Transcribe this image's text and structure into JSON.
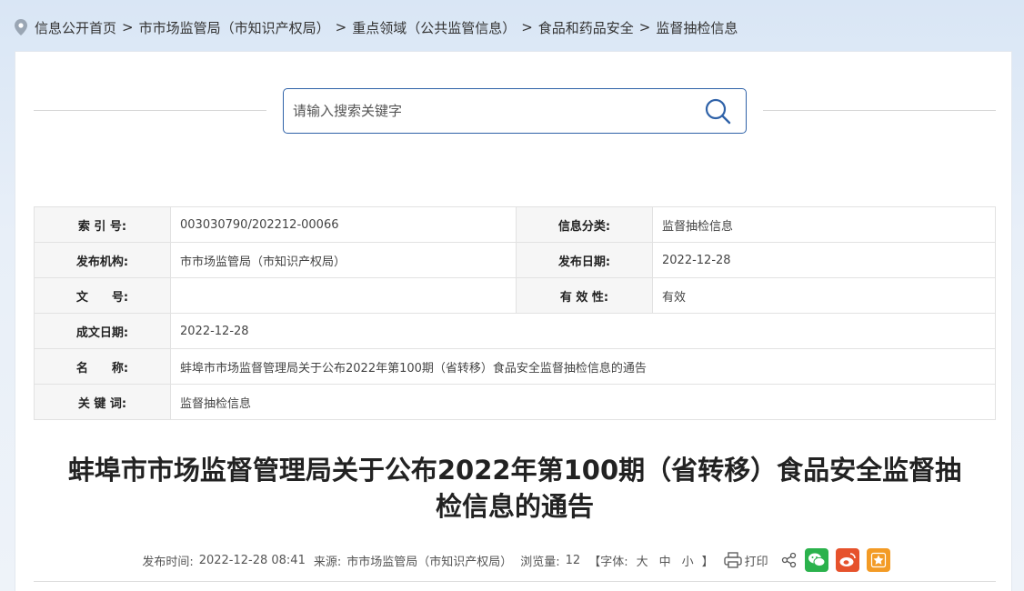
{
  "breadcrumb": {
    "items": [
      "信息公开首页",
      "市市场监管局（市知识产权局）",
      "重点领域（公共监管信息）",
      "食品和药品安全",
      "监督抽检信息"
    ],
    "separator": ">"
  },
  "search": {
    "placeholder": "请输入搜索关键字"
  },
  "meta": {
    "index_label": "索 引 号:",
    "index_value": "003030790/202212-00066",
    "category_label": "信息分类:",
    "category_value": "监督抽检信息",
    "publisher_label": "发布机构:",
    "publisher_value": "市市场监管局（市知识产权局）",
    "pubdate_label": "发布日期:",
    "pubdate_value": "2022-12-28",
    "docno_label": "文　　号:",
    "docno_value": "",
    "validity_label": "有 效 性:",
    "validity_value": "有效",
    "created_label": "成文日期:",
    "created_value": "2022-12-28",
    "name_label": "名　　称:",
    "name_value": "蚌埠市市场监督管理局关于公布2022年第100期（省转移）食品安全监督抽检信息的通告",
    "keywords_label": "关 键 词:",
    "keywords_value": "监督抽检信息"
  },
  "article": {
    "title_line1": "蚌埠市市场监督管理局关于公布2022年第100期（省转移）食品安全监督抽",
    "title_line2": "检信息的通告"
  },
  "info": {
    "time_label": "发布时间:",
    "time_value": "2022-12-28 08:41",
    "source_label": "来源:",
    "source_value": "市市场监管局（市知识产权局）",
    "views_label": "浏览量:",
    "views_value": "12",
    "font_label": "【字体:",
    "font_large": "大",
    "font_medium": "中",
    "font_small": "小",
    "font_end": "】",
    "print_label": "打印"
  },
  "colors": {
    "accent": "#2f62a8",
    "wechat": "#2bb24c",
    "weibo": "#e6522c",
    "favorite": "#f39b25"
  }
}
